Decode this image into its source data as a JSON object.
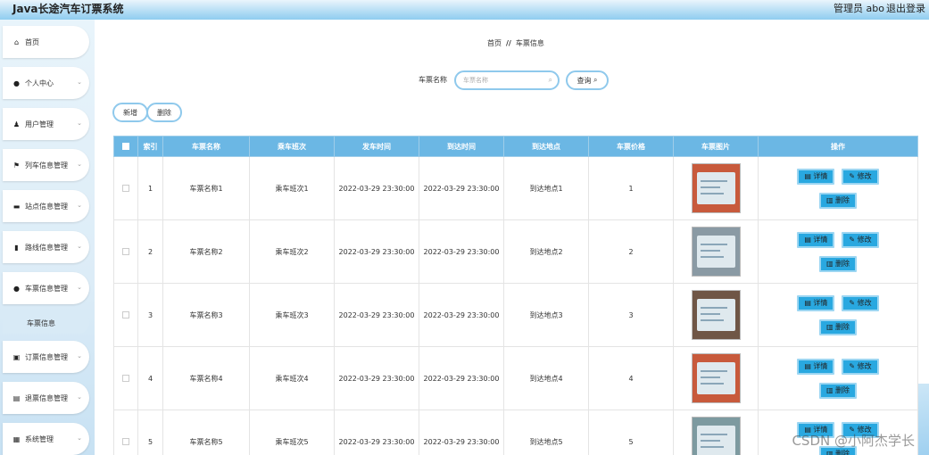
{
  "header": {
    "title": "Java长途汽车订票系统",
    "user": "管理员 abo",
    "logout": "退出登录"
  },
  "sidebar": {
    "items": [
      {
        "label": "首页",
        "icon": "home-icon",
        "glyph": "⌂"
      },
      {
        "label": "个人中心",
        "icon": "person-icon",
        "glyph": "●"
      },
      {
        "label": "用户管理",
        "icon": "users-icon",
        "glyph": "♟"
      },
      {
        "label": "列车信息管理",
        "icon": "flag-icon",
        "glyph": "⚑"
      },
      {
        "label": "站点信息管理",
        "icon": "briefcase-icon",
        "glyph": "▬"
      },
      {
        "label": "路线信息管理",
        "icon": "bar-chart-icon",
        "glyph": "▮"
      },
      {
        "label": "车票信息管理",
        "icon": "location-pin-icon",
        "glyph": "●"
      },
      {
        "label": "订票信息管理",
        "icon": "calendar-icon",
        "glyph": "▣"
      },
      {
        "label": "退票信息管理",
        "icon": "wallet-icon",
        "glyph": "▤"
      },
      {
        "label": "系统管理",
        "icon": "grid-icon",
        "glyph": "▦"
      }
    ],
    "submenu_active": "车票信息"
  },
  "breadcrumb": {
    "home": "首页",
    "sep": "//",
    "current": "车票信息"
  },
  "search": {
    "label": "车票名称",
    "placeholder": "车票名称",
    "button": "查询"
  },
  "toolbar": {
    "add": "新增",
    "delete": "删除"
  },
  "table": {
    "headers": [
      "索引",
      "车票名称",
      "乘车班次",
      "发车时间",
      "到达时间",
      "到达地点",
      "车票价格",
      "车票图片",
      "操作"
    ],
    "rows": [
      {
        "index": "1",
        "name": "车票名称1",
        "shift": "乘车班次1",
        "depart": "2022-03-29 23:30:00",
        "arrive": "2022-03-29 23:30:00",
        "place": "到达地点1",
        "price": "1",
        "img": "#c85a3c"
      },
      {
        "index": "2",
        "name": "车票名称2",
        "shift": "乘车班次2",
        "depart": "2022-03-29 23:30:00",
        "arrive": "2022-03-29 23:30:00",
        "place": "到达地点2",
        "price": "2",
        "img": "#8a9aa4"
      },
      {
        "index": "3",
        "name": "车票名称3",
        "shift": "乘车班次3",
        "depart": "2022-03-29 23:30:00",
        "arrive": "2022-03-29 23:30:00",
        "place": "到达地点3",
        "price": "3",
        "img": "#6f5646"
      },
      {
        "index": "4",
        "name": "车票名称4",
        "shift": "乘车班次4",
        "depart": "2022-03-29 23:30:00",
        "arrive": "2022-03-29 23:30:00",
        "place": "到达地点4",
        "price": "4",
        "img": "#c85a3c"
      },
      {
        "index": "5",
        "name": "车票名称5",
        "shift": "乘车班次5",
        "depart": "2022-03-29 23:30:00",
        "arrive": "2022-03-29 23:30:00",
        "place": "到达地点5",
        "price": "5",
        "img": "#7d9aa0"
      }
    ],
    "actions": {
      "detail": "详情",
      "edit": "修改",
      "delete": "删除"
    }
  },
  "watermark": "CSDN @小阿杰学长"
}
